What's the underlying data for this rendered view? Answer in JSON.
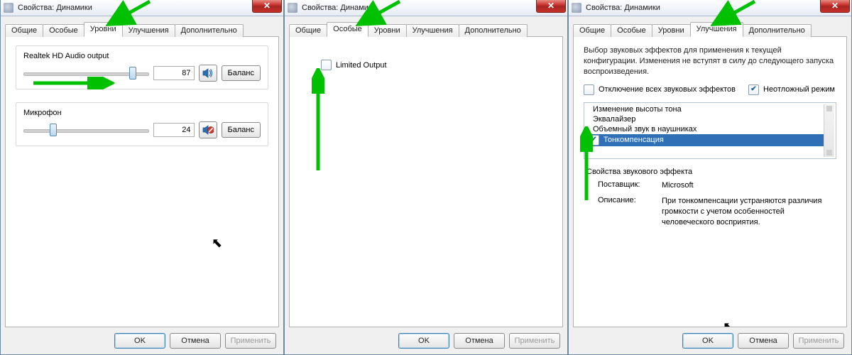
{
  "arrow_color": "#00c000",
  "windows": [
    {
      "title": "Свойства: Динамики",
      "tabs": [
        "Общие",
        "Особые",
        "Уровни",
        "Улучшения",
        "Дополнительно"
      ],
      "active_tab": 2,
      "buttons": {
        "ok": "OK",
        "cancel": "Отмена",
        "apply": "Применить"
      },
      "levels": [
        {
          "label": "Realtek HD Audio output",
          "value": 87,
          "slider_percent": 87,
          "icon": "speaker-icon",
          "muted": false,
          "balance": "Баланс"
        },
        {
          "label": "Микрофон",
          "value": 24,
          "slider_percent": 24,
          "icon": "mic-muted-icon",
          "muted": true,
          "balance": "Баланс"
        }
      ]
    },
    {
      "title": "Свойства: Динамики",
      "tabs": [
        "Общие",
        "Особые",
        "Уровни",
        "Улучшения",
        "Дополнительно"
      ],
      "active_tab": 1,
      "buttons": {
        "ok": "OK",
        "cancel": "Отмена",
        "apply": "Применить"
      },
      "special": {
        "limited_output_label": "Limited Output",
        "limited_output_checked": false
      }
    },
    {
      "title": "Свойства: Динамики",
      "tabs": [
        "Общие",
        "Особые",
        "Уровни",
        "Улучшения",
        "Дополнительно"
      ],
      "active_tab": 3,
      "buttons": {
        "ok": "OK",
        "cancel": "Отмена",
        "apply": "Применить"
      },
      "enh": {
        "description": "Выбор звуковых эффектов для применения к текущей конфигурации. Изменения не вступят в силу до следующего запуска воспроизведения.",
        "disable_all_label": "Отключение всех звуковых эффектов",
        "disable_all_checked": false,
        "immediate_label": "Неотложный режим",
        "immediate_checked": true,
        "effects": [
          {
            "label": "Изменение высоты тона",
            "checked": false,
            "selected": false
          },
          {
            "label": "Эквалайзер",
            "checked": false,
            "selected": false
          },
          {
            "label": "Объемный звук в наушниках",
            "checked": false,
            "selected": false
          },
          {
            "label": "Тонкомпенсация",
            "checked": true,
            "selected": true
          }
        ],
        "props_title": "Свойства звукового эффекта",
        "provider_label": "Поставщик:",
        "provider_value": "Microsoft",
        "desc_label": "Описание:",
        "desc_value": "При тонкомпенсации устраняются различия громкости с учетом особенностей человеческого восприятия."
      }
    }
  ]
}
